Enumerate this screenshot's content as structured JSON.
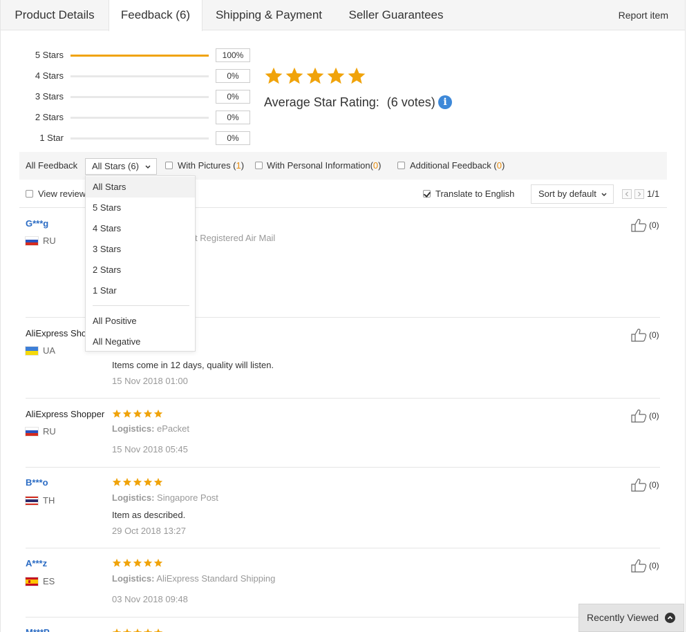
{
  "tabs": {
    "product_details": "Product Details",
    "feedback": "Feedback (6)",
    "shipping": "Shipping & Payment",
    "seller": "Seller Guarantees",
    "report": "Report item"
  },
  "histogram": [
    {
      "label": "5 Stars",
      "pct_text": "100%",
      "fraction": 1.0
    },
    {
      "label": "4 Stars",
      "pct_text": "0%",
      "fraction": 0
    },
    {
      "label": "3 Stars",
      "pct_text": "0%",
      "fraction": 0
    },
    {
      "label": "2 Stars",
      "pct_text": "0%",
      "fraction": 0
    },
    {
      "label": "1 Star",
      "pct_text": "0%",
      "fraction": 0
    }
  ],
  "average": {
    "stars": 5,
    "label": "Average Star Rating:",
    "votes": "(6 votes)",
    "info_icon": "info-icon"
  },
  "filter": {
    "all_feedback": "All Feedback",
    "select_value": "All Stars (6)",
    "with_pictures_label": "With Pictures (",
    "with_pictures_count": "1",
    "with_personal_label": "With Personal Information(",
    "with_personal_count": "0",
    "additional_label": "Additional Feedback (",
    "additional_count": "0",
    "close_paren": ")"
  },
  "toolbar": {
    "view_reviews": "View review",
    "translate": "Translate to English",
    "translate_checked": true,
    "sort": "Sort by default",
    "page": "1/1"
  },
  "dropdown": {
    "items": [
      "All Stars",
      "5 Stars",
      "4 Stars",
      "3 Stars",
      "2 Stars",
      "1 Star"
    ],
    "items2": [
      "All Positive",
      "All Negative"
    ],
    "selected": "All Stars"
  },
  "reviews": [
    {
      "name": "G***g",
      "country": "RU",
      "logistics_text": "t Registered Air Mail",
      "likes": "(0)"
    },
    {
      "name": "AliExpress Sho",
      "country": "UA",
      "feedback": "Items come in 12 days, quality will listen.",
      "date": "15 Nov 2018 01:00",
      "likes": "(0)"
    },
    {
      "name": "AliExpress Shopper",
      "country": "RU",
      "logistics_label": "Logistics:",
      "logistics": "ePacket",
      "date": "15 Nov 2018 05:45",
      "likes": "(0)"
    },
    {
      "name": "B***o",
      "country": "TH",
      "logistics_label": "Logistics:",
      "logistics": "Singapore Post",
      "feedback": "Item as described.",
      "date": "29 Oct 2018 13:27",
      "likes": "(0)"
    },
    {
      "name": "A***z",
      "country": "ES",
      "logistics_label": "Logistics:",
      "logistics": "AliExpress Standard Shipping",
      "date": "03 Nov 2018 09:48",
      "likes": "(0)"
    },
    {
      "name": "M***P"
    }
  ],
  "recently_viewed": "Recently Viewed",
  "colors": {
    "star": "#f0a30a",
    "link_blue": "#2b6cc4",
    "orange_count": "#e88d0e",
    "info_blue": "#3d88d8"
  }
}
